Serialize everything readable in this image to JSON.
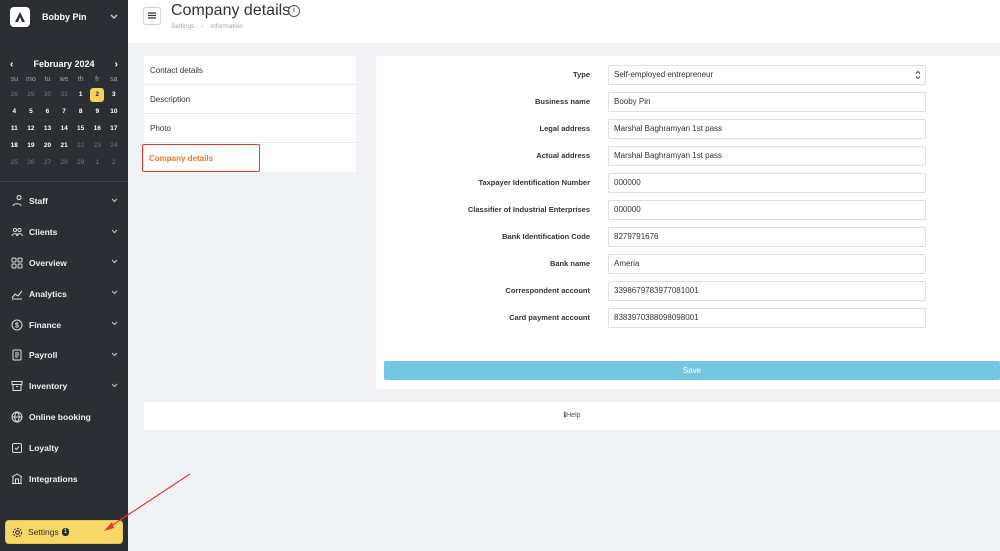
{
  "sidebar": {
    "user_name": "Bobby Pin",
    "calendar": {
      "month_label": "February 2024",
      "prev": "‹",
      "next": "›",
      "weekdays": [
        "su",
        "mo",
        "tu",
        "we",
        "th",
        "fr",
        "sa"
      ],
      "days": [
        {
          "d": "28",
          "m": true
        },
        {
          "d": "29",
          "m": true
        },
        {
          "d": "30",
          "m": true
        },
        {
          "d": "31",
          "m": true
        },
        {
          "d": "1",
          "m": false
        },
        {
          "d": "2",
          "m": false,
          "today": true
        },
        {
          "d": "3",
          "m": false
        },
        {
          "d": "4",
          "m": false
        },
        {
          "d": "5",
          "m": false
        },
        {
          "d": "6",
          "m": false
        },
        {
          "d": "7",
          "m": false
        },
        {
          "d": "8",
          "m": false
        },
        {
          "d": "9",
          "m": false
        },
        {
          "d": "10",
          "m": false
        },
        {
          "d": "11",
          "m": false
        },
        {
          "d": "12",
          "m": false
        },
        {
          "d": "13",
          "m": false
        },
        {
          "d": "14",
          "m": false
        },
        {
          "d": "15",
          "m": false
        },
        {
          "d": "16",
          "m": false
        },
        {
          "d": "17",
          "m": false
        },
        {
          "d": "18",
          "m": false
        },
        {
          "d": "19",
          "m": false
        },
        {
          "d": "20",
          "m": false
        },
        {
          "d": "21",
          "m": false
        },
        {
          "d": "22",
          "m": true
        },
        {
          "d": "23",
          "m": true
        },
        {
          "d": "24",
          "m": true
        },
        {
          "d": "25",
          "m": true
        },
        {
          "d": "26",
          "m": true
        },
        {
          "d": "27",
          "m": true
        },
        {
          "d": "28",
          "m": true
        },
        {
          "d": "29",
          "m": true
        },
        {
          "d": "1",
          "m": true
        },
        {
          "d": "2",
          "m": true
        }
      ]
    },
    "nav": [
      {
        "label": "Staff",
        "icon": "staff-icon"
      },
      {
        "label": "Clients",
        "icon": "clients-icon"
      },
      {
        "label": "Overview",
        "icon": "overview-icon"
      },
      {
        "label": "Analytics",
        "icon": "analytics-icon"
      },
      {
        "label": "Finance",
        "icon": "finance-icon"
      },
      {
        "label": "Payroll",
        "icon": "payroll-icon"
      },
      {
        "label": "Inventory",
        "icon": "inventory-icon"
      },
      {
        "label": "Online booking",
        "icon": "online-booking-icon"
      },
      {
        "label": "Loyalty",
        "icon": "loyalty-icon"
      },
      {
        "label": "Integrations",
        "icon": "integrations-icon"
      }
    ],
    "settings_label": "Settings",
    "settings_badge": "1"
  },
  "header": {
    "title": "Company details",
    "breadcrumb": [
      "Settings",
      "Information"
    ],
    "breadcrumb_sep": "›"
  },
  "tabs": {
    "contact": "Contact details",
    "description": "Description",
    "photo": "Photo",
    "company": "Company details"
  },
  "form": {
    "type_label": "Type",
    "type_value": "Self-employed entrepreneur",
    "business_name_label": "Business name",
    "business_name_value": "Booby Pin",
    "legal_address_label": "Legal address",
    "legal_address_value": "Marshal Baghramyan 1st pass",
    "actual_address_label": "Actual address",
    "actual_address_value": "Marshal Baghramyan 1st pass",
    "tin_label": "Taxpayer Identification Number",
    "tin_value": "000000",
    "classifier_label": "Classifier of Industrial Enterprises",
    "classifier_value": "000000",
    "bic_label": "Bank Identification Code",
    "bic_value": "8279791676",
    "bank_name_label": "Bank name",
    "bank_name_value": "Ameria",
    "corr_label": "Correspondent account",
    "corr_value": "3398679783977081001",
    "card_label": "Card payment account",
    "card_value": "8383970388098098001",
    "save_label": "Save"
  },
  "help": {
    "icon": "info-icon",
    "label": "Help"
  },
  "colors": {
    "sidebar_bg": "#2b2f33",
    "accent_yellow": "#f7d867",
    "active_tab": "#e8792b",
    "save_button": "#74c6e3",
    "annotation_red": "#e53c2e"
  }
}
